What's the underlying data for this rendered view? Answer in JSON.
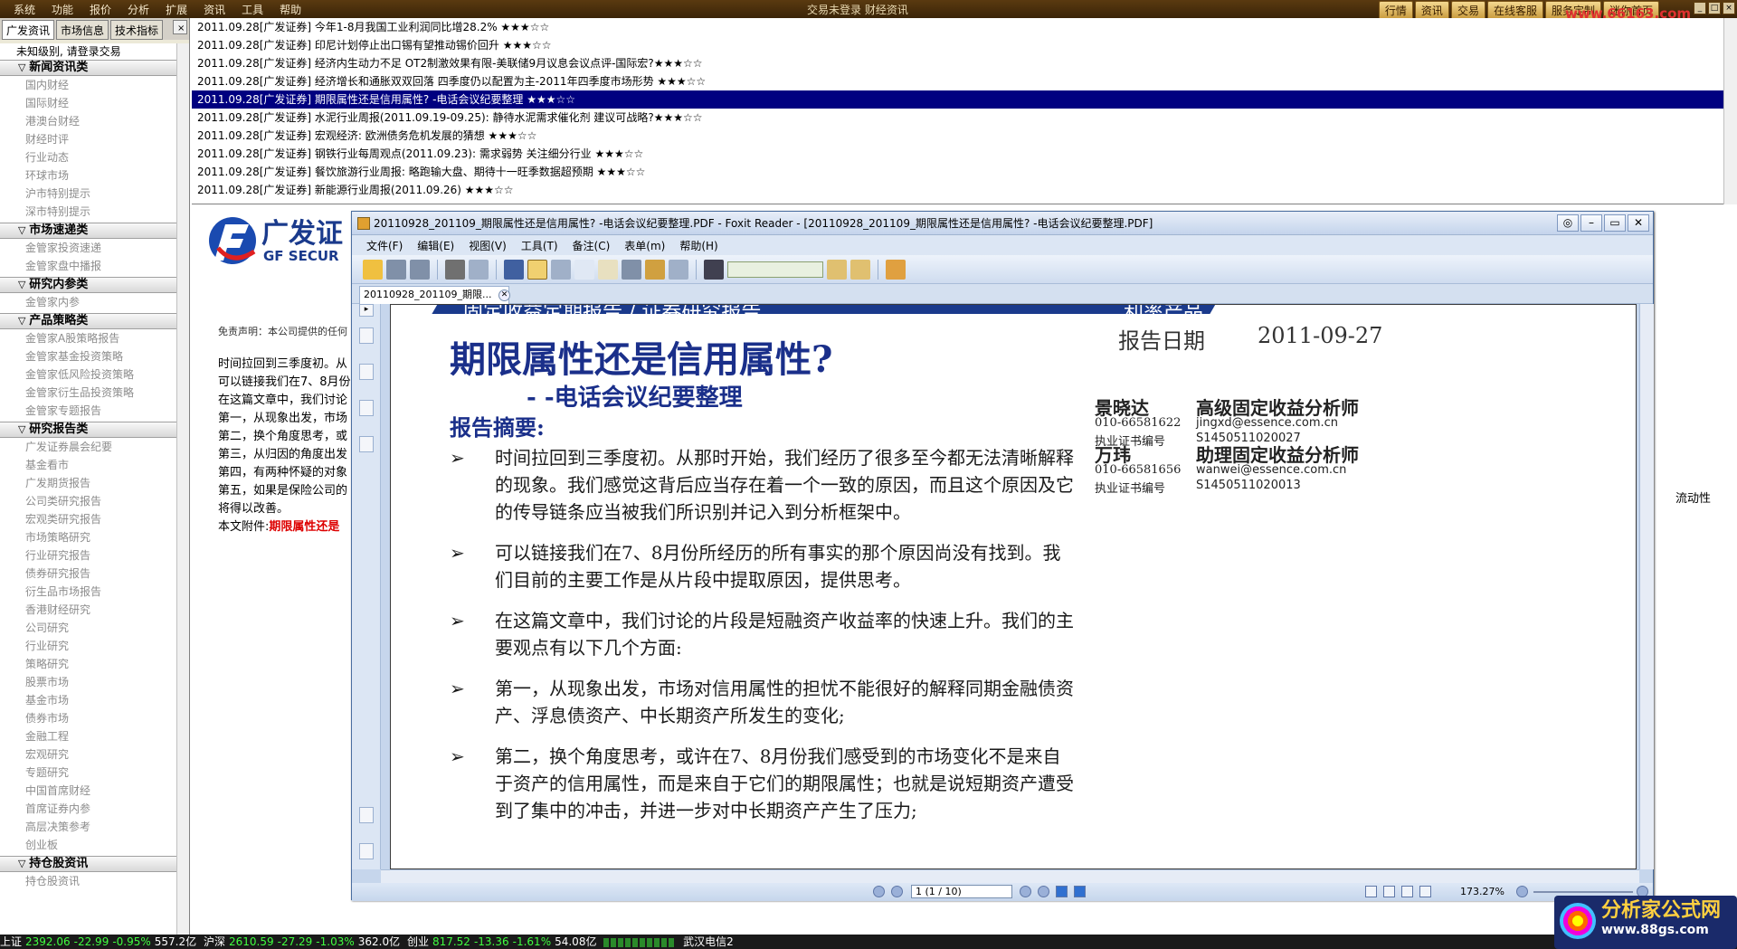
{
  "topbar": {
    "menu": [
      "系统",
      "功能",
      "报价",
      "分析",
      "扩展",
      "资讯",
      "工具",
      "帮助"
    ],
    "login_status": "交易未登录 财经资讯",
    "right_buttons": [
      "行情",
      "资讯",
      "交易",
      "在线客服",
      "服务定制",
      "迷你首页"
    ],
    "watermark": "www.66163.com",
    "win_controls": [
      "_",
      "□",
      "×"
    ]
  },
  "sidebar": {
    "tabs": [
      "广发资讯",
      "市场信息",
      "技术指标"
    ],
    "close": "×",
    "notice": "未知级别, 请登录交易",
    "sections": [
      {
        "title": "新闻资讯类",
        "items": [
          "国内财经",
          "国际财经",
          "港澳台财经",
          "财经时评",
          "行业动态",
          "环球市场",
          "沪市特别提示",
          "深市特别提示"
        ]
      },
      {
        "title": "市场速递类",
        "items": [
          "金管家投资速递",
          "金管家盘中播报"
        ]
      },
      {
        "title": "研究内参类",
        "items": [
          "金管家内参"
        ]
      },
      {
        "title": "产品策略类",
        "items": [
          "金管家A股策略报告",
          "金管家基金投资策略",
          "金管家低风险投资策略",
          "金管家衍生品投资策略",
          "金管家专题报告"
        ]
      },
      {
        "title": "研究报告类",
        "items": [
          "广发证券晨会纪要",
          "基金看市",
          "广发期货报告",
          "公司类研究报告",
          "宏观类研究报告",
          "市场策略研究",
          "行业研究报告",
          "债券研究报告",
          "衍生品市场报告",
          "香港财经研究",
          "公司研究",
          "行业研究",
          "策略研究",
          "股票市场",
          "基金市场",
          "债券市场",
          "金融工程",
          "宏观研究",
          "专题研究",
          "中国首席财经",
          "首席证券内参",
          "高层决策参考",
          "创业板"
        ]
      },
      {
        "title": "持仓股资讯",
        "items": [
          "持仓股资讯"
        ]
      }
    ]
  },
  "news": [
    {
      "text": "2011.09.28[广发证券] 今年1-8月我国工业利润同比增28.2% ★★★☆☆",
      "selected": false
    },
    {
      "text": "2011.09.28[广发证券] 印尼计划停止出口锡有望推动锡价回升 ★★★☆☆",
      "selected": false
    },
    {
      "text": "2011.09.28[广发证券] 经济内生动力不足 OT2制激效果有限-美联储9月议息会议点评-国际宏?★★★☆☆",
      "selected": false
    },
    {
      "text": "2011.09.28[广发证券] 经济增长和通胀双双回落 四季度仍以配置为主-2011年四季度市场形势 ★★★☆☆",
      "selected": false
    },
    {
      "text": "2011.09.28[广发证券] 期限属性还是信用属性? -电话会议纪要整理 ★★★☆☆",
      "selected": true
    },
    {
      "text": "2011.09.28[广发证券] 水泥行业周报(2011.09.19-09.25): 静待水泥需求催化剂 建议可战略?★★★☆☆",
      "selected": false
    },
    {
      "text": "2011.09.28[广发证券] 宏观经济: 欧洲债务危机发展的猜想 ★★★☆☆",
      "selected": false
    },
    {
      "text": "2011.09.28[广发证券] 钢铁行业每周观点(2011.09.23): 需求弱势 关注细分行业 ★★★☆☆",
      "selected": false
    },
    {
      "text": "2011.09.28[广发证券] 餐饮旅游行业周报: 略跑输大盘、期待十一旺季数据超预期 ★★★☆☆",
      "selected": false
    },
    {
      "text": "2011.09.28[广发证券] 新能源行业周报(2011.09.26) ★★★☆☆",
      "selected": false
    }
  ],
  "content": {
    "logo_cn": "广发证",
    "logo_en": "GF SECUR",
    "disclaimer": "免责声明：本公司提供的任何",
    "paras": [
      "时间拉回到三季度初。从",
      "可以链接我们在7、8月份",
      "在这篇文章中，我们讨论",
      "第一，从现象出发，市场",
      "第二，换个角度思考，或",
      "第三，从归因的角度出发",
      "第四，有两种怀疑的对象",
      "第五，如果是保险公司的",
      "将得以改善。"
    ],
    "attachment_label": "本文附件:",
    "attachment_link": "期限属性还是",
    "right_fragment": "流动性"
  },
  "pdf": {
    "title": "20110928_201109_期限属性还是信用属性? -电话会议纪要整理.PDF - Foxit Reader - [20110928_201109_期限属性还是信用属性? -电话会议纪要整理.PDF]",
    "menus": [
      "文件(F)",
      "编辑(E)",
      "视图(V)",
      "工具(T)",
      "备注(C)",
      "表单(m)",
      "帮助(H)"
    ],
    "tab_label": "20110928_201109_期限...",
    "page_indicator": "1 (1 / 10)",
    "zoom": "173.27%",
    "doc": {
      "banner_left": "固定收益定期报告 / 证券研究报告",
      "banner_right": "利率产品",
      "title": "期限属性还是信用属性?",
      "subtitle": "- -电话会议纪要整理",
      "date_label": "报告日期",
      "date": "2011-09-27",
      "abstract_label": "报告摘要:",
      "bullets": [
        "时间拉回到三季度初。从那时开始，我们经历了很多至今都无法清晰解释的现象。我们感觉这背后应当存在着一个一致的原因，而且这个原因及它的传导链条应当被我们所识别并记入到分析框架中。",
        "可以链接我们在7、8月份所经历的所有事实的那个原因尚没有找到。我们目前的主要工作是从片段中提取原因，提供思考。",
        "在这篇文章中，我们讨论的片段是短融资产收益率的快速上升。我们的主要观点有以下几个方面:",
        "第一，从现象出发，市场对信用属性的担忧不能很好的解释同期金融债资产、浮息债资产、中长期资产所发生的变化;",
        "第二，换个角度思考，或许在7、8月份我们感受到的市场变化不是来自于资产的信用属性，而是来自于它们的期限属性；也就是说短期资产遭受到了集中的冲击，并进一步对中长期资产产生了压力;"
      ],
      "analysts": [
        {
          "name": "景晓达",
          "role": "高级固定收益分析师",
          "phone": "010-66581622",
          "email": "jingxd@essence.com.cn",
          "cert_label": "执业证书编号",
          "cert": "S1450511020027"
        },
        {
          "name": "万玮",
          "role": "助理固定收益分析师",
          "phone": "010-66581656",
          "email": "wanwei@essence.com.cn",
          "cert_label": "执业证书编号",
          "cert": "S1450511020013"
        }
      ]
    }
  },
  "statusbar": {
    "sh_label": "上证",
    "sh_val": "2392.06",
    "sh_chg": "-22.99",
    "sh_pct": "-0.95%",
    "sh_amt": "557.2亿",
    "hs_label": "沪深",
    "hs_val": "2610.59",
    "hs_chg": "-27.29",
    "hs_pct": "-1.03%",
    "hs_amt": "362.0亿",
    "cy_label": "创业",
    "cy_val": "817.52",
    "cy_chg": "-13.36",
    "cy_pct": "-1.61%",
    "cy_amt": "54.08亿",
    "network": "武汉电信2"
  },
  "badge": {
    "title": "分析家公式网",
    "url": "www.88gs.com"
  },
  "colors": {
    "selected_row": "#000080",
    "doc_blue": "#1a2f8a",
    "topbar": "#4a2e0c"
  }
}
